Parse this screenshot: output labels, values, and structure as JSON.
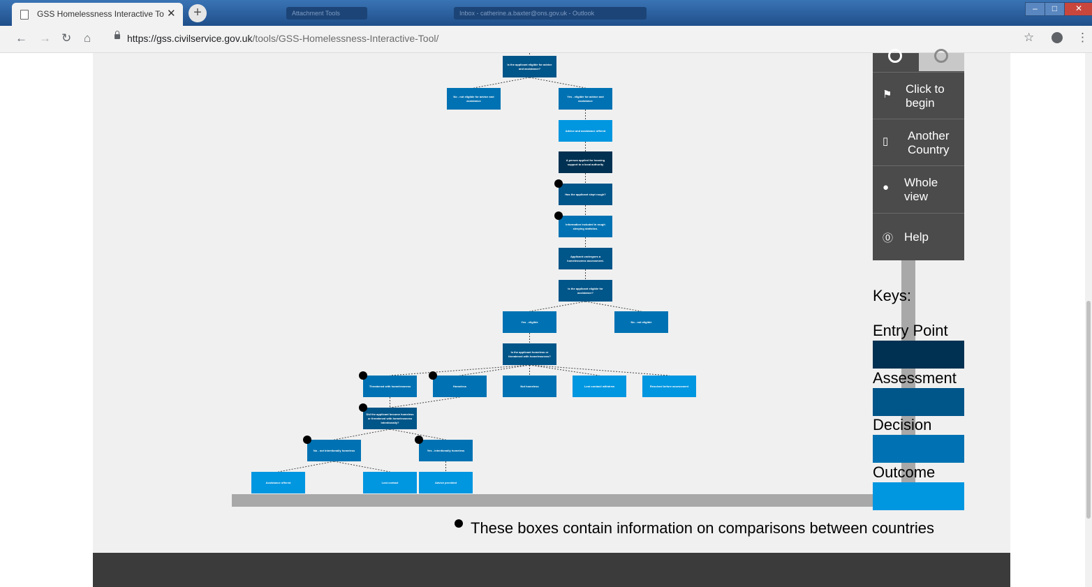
{
  "browser": {
    "tab_title": "GSS Homelessness Interactive To",
    "background_tabs": [
      "Attachment Tools",
      "Inbox - catherine.a.baxter@ons.gov.uk - Outlook"
    ],
    "url_host": "https://gss.civilservice.gov.uk",
    "url_path": "/tools/GSS-Homelessness-Interactive-Tool/"
  },
  "controls": {
    "begin": "Click to begin",
    "begin_line1": "Click to",
    "begin_line2": "begin",
    "another_line1": "Another",
    "another_line2": "Country",
    "whole_line1": "Whole",
    "whole_line2": "view",
    "help": "Help"
  },
  "keys": {
    "title": "Keys:",
    "items": [
      {
        "label": "Entry Point",
        "color": "#003152"
      },
      {
        "label": "Assessment",
        "color": "#005589"
      },
      {
        "label": "Decision",
        "color": "#0072b3"
      },
      {
        "label": "Outcome",
        "color": "#0096e0"
      }
    ]
  },
  "dot_legend": "These boxes contain information on comparisons between countries",
  "tree": {
    "nodes": [
      {
        "id": "n1",
        "type": "assess",
        "text": "Is the applicant eligible for advice and assistance?"
      },
      {
        "id": "n2",
        "type": "decision",
        "text": "No - not eligible for advice and assistance"
      },
      {
        "id": "n3",
        "type": "decision",
        "text": "Yes - eligible for advice and assistance"
      },
      {
        "id": "n4",
        "type": "outcome",
        "text": "Advice and assistance offered"
      },
      {
        "id": "n5",
        "type": "entry",
        "text": "A person applied for housing support to a local authority"
      },
      {
        "id": "n6",
        "type": "assess",
        "text": "Has the applicant slept rough?"
      },
      {
        "id": "n7",
        "type": "decision",
        "text": "Information included in rough sleeping statistics."
      },
      {
        "id": "n8",
        "type": "assess",
        "text": "Applicant undergoes a homelessness assessment."
      },
      {
        "id": "n9",
        "type": "assess",
        "text": "Is the applicant eligible for assistance?"
      },
      {
        "id": "n10",
        "type": "decision",
        "text": "Yes - eligible"
      },
      {
        "id": "n11",
        "type": "decision",
        "text": "No - not eligible"
      },
      {
        "id": "n12",
        "type": "assess",
        "text": "Is the applicant homeless or threatened with homelessness?"
      },
      {
        "id": "n13",
        "type": "decision",
        "text": "Threatened with homelessness"
      },
      {
        "id": "n14",
        "type": "decision",
        "text": "Homeless"
      },
      {
        "id": "n15",
        "type": "decision",
        "text": "Not homeless"
      },
      {
        "id": "n16",
        "type": "outcome",
        "text": "Lost contact/ withdrew"
      },
      {
        "id": "n17",
        "type": "outcome",
        "text": "Resolved before assessment"
      },
      {
        "id": "n18",
        "type": "assess",
        "text": "Did the applicant become homeless or threatened with homelessness intentionally?"
      },
      {
        "id": "n19",
        "type": "decision",
        "text": "No - not intentionally homeless"
      },
      {
        "id": "n20",
        "type": "decision",
        "text": "Yes - intentionally homeless"
      },
      {
        "id": "n21",
        "type": "outcome",
        "text": "Assistance offered"
      },
      {
        "id": "n22",
        "type": "outcome",
        "text": "Lost contact"
      },
      {
        "id": "n23",
        "type": "outcome",
        "text": "Advice provided"
      }
    ]
  }
}
